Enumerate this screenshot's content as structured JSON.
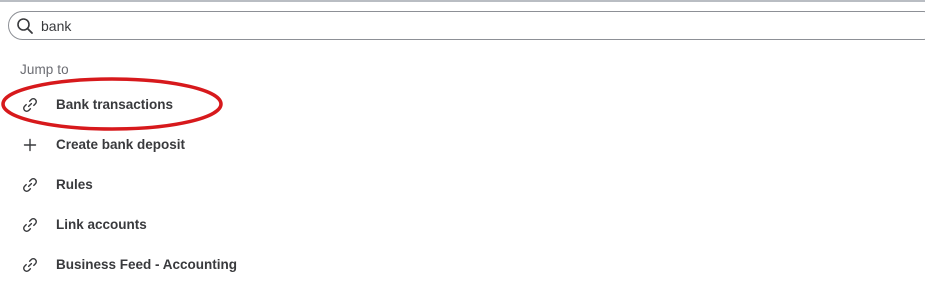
{
  "search": {
    "value": "bank",
    "icon": "search-icon"
  },
  "section": {
    "label": "Jump to"
  },
  "results": [
    {
      "label": "Bank transactions",
      "icon": "link-icon"
    },
    {
      "label": "Create bank deposit",
      "icon": "plus-icon"
    },
    {
      "label": "Rules",
      "icon": "link-icon"
    },
    {
      "label": "Link accounts",
      "icon": "link-icon"
    },
    {
      "label": "Business Feed - Accounting",
      "icon": "link-icon"
    }
  ],
  "annotation": {
    "highlighted_item": "Bank transactions",
    "color": "#d7191c"
  },
  "colors": {
    "text": "#393a3d",
    "muted": "#6b6c72",
    "border": "#8d9096"
  }
}
